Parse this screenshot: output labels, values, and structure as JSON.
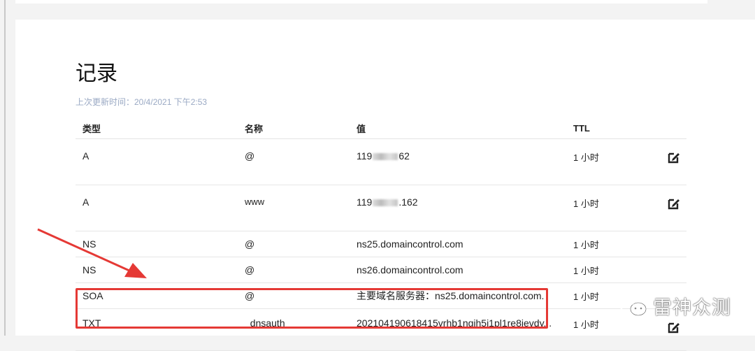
{
  "page": {
    "title": "记录",
    "last_updated": "上次更新时间：20/4/2021 下午2:53"
  },
  "table": {
    "headers": [
      "类型",
      "名称",
      "值",
      "TTL"
    ],
    "rows": [
      {
        "type": "A",
        "name": "@",
        "value_prefix": "119",
        "value_suffix": "62",
        "ttl": "1 小时",
        "editable": true
      },
      {
        "type": "A",
        "name": "www",
        "value_prefix": "119",
        "value_suffix": ".162",
        "ttl": "1 小时",
        "editable": true
      },
      {
        "type": "NS",
        "name": "@",
        "value": "ns25.domaincontrol.com",
        "ttl": "1 小时",
        "editable": false
      },
      {
        "type": "NS",
        "name": "@",
        "value": "ns26.domaincontrol.com",
        "ttl": "1 小时",
        "editable": false
      },
      {
        "type": "SOA",
        "name": "@",
        "value": "主要域名服务器：ns25.domaincontrol.com.",
        "ttl": "1 小时",
        "editable": false
      },
      {
        "type": "TXT",
        "name": "_dnsauth",
        "value": "202104190618415vrhb1ngjh5i1pl1re8jevdy...",
        "ttl": "1 小时",
        "editable": true
      }
    ]
  },
  "annotation": {
    "arrow_color": "#e53935",
    "box_color": "#e53935"
  },
  "watermark": {
    "text": "雷神众测",
    "icon": "wechat-icon"
  }
}
